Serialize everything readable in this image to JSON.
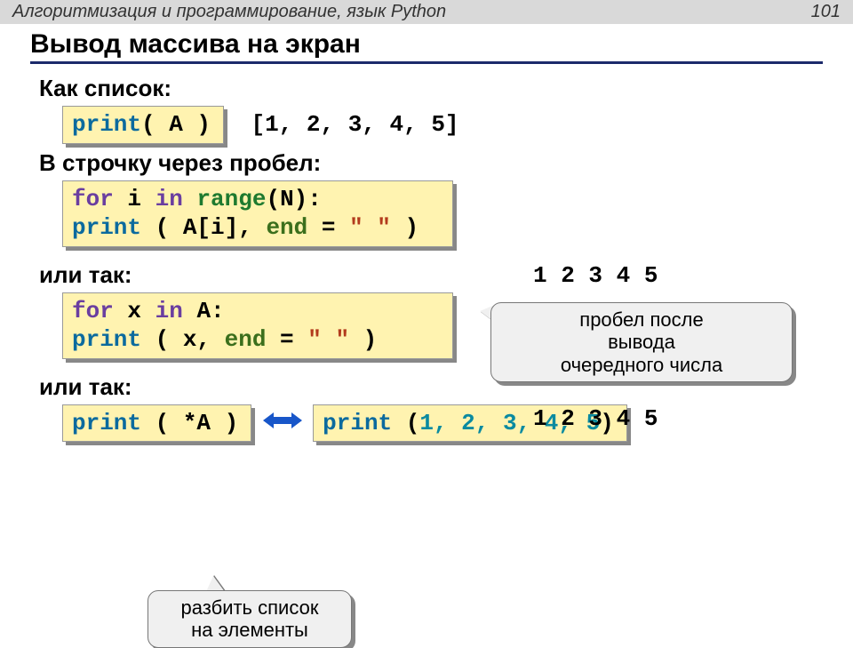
{
  "topbar": {
    "course": "Алгоритмизация и программирование, язык Python",
    "page": "101"
  },
  "title": "Вывод массива на экран",
  "labels": {
    "as_list": "Как список:",
    "inline_space": "В строчку через пробел:",
    "or_so_1": "или так:",
    "or_so_2": "или так:"
  },
  "code": {
    "c1": {
      "print": "print",
      "body": "( A )"
    },
    "c2": {
      "for": "for",
      "i": " i ",
      "in": "in",
      "sp": " ",
      "range": "range",
      "args": "(N):",
      "indent": "   ",
      "print": "print",
      "open": " ( A[i], ",
      "end": "end",
      "eq": " = ",
      "str": "\" \"",
      "close": " )"
    },
    "c3": {
      "for": "for",
      "x": " x ",
      "in": "in",
      "A": " A:",
      "indent": "   ",
      "print": "print",
      "open": " (  x,  ",
      "end": "end",
      "eq": " = ",
      "str": "\" \"",
      "close": " )"
    },
    "c4": {
      "print": "print",
      "body": " ( *A )"
    },
    "c5": {
      "print": "print",
      "open": " (",
      "nums": "1, 2, 3, 4, 5",
      "close": ")"
    }
  },
  "outputs": {
    "o1": "[1, 2, 3, 4, 5]",
    "o2": "1 2 3 4 5",
    "o3": "1 2 3 4 5"
  },
  "callouts": {
    "c1_l1": "пробел после",
    "c1_l2": "вывода",
    "c1_l3": "очередного числа",
    "c2_l1": "разбить список",
    "c2_l2": "на элементы"
  }
}
